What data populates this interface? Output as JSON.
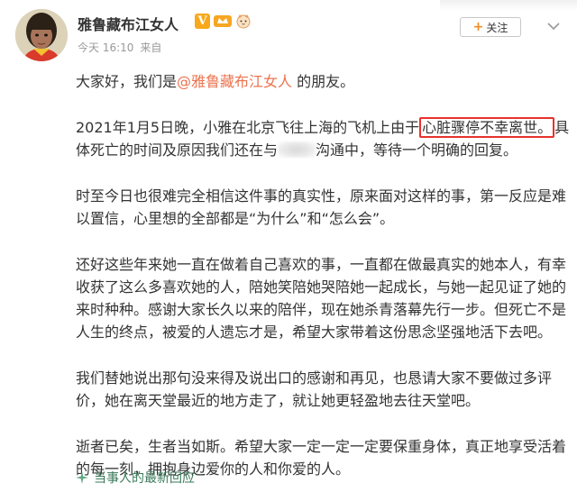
{
  "header": {
    "username": "雅鲁藏布江女人",
    "timestamp": "今天 16:10",
    "source_prefix": "来自",
    "follow_label": "关注",
    "verified_badge": "V"
  },
  "post": {
    "p1_before": "大家好，我们是",
    "p1_mention": "@雅鲁藏布江女人",
    "p1_after": " 的朋友。",
    "p2_before": "2021年1月5日晚，小雅在北京飞往上海的飞机上由于",
    "p2_highlight": "心脏骤停不幸离世。",
    "p2_middle": "具体死亡的时间及原因我们还在与",
    "p2_after": "沟通中，等待一个明确的回复。",
    "p3": "时至今日也很难完全相信这件事的真实性，原来面对这样的事，第一反应是难以置信，心里想的全部都是“为什么”和“怎么会”。",
    "p4": "还好这些年来她一直在做着自己喜欢的事，一直都在做最真实的她本人，有幸收获了这么多喜欢她的人，陪她笑陪她哭陪她一起成长，与她一起见证了她的来时种种。感谢大家长久以来的陪伴，现在她杀青落幕先行一步。但死亡不是人生的终点，被爱的人遗忘才是，希望大家带着这份思念坚强地活下去吧。",
    "p5": "我们替她说出那句没来得及说出口的感谢和再见，也恳请大家不要做过多评价，她在离天堂最近的地方走了，就让她更轻盈地去往天堂吧。",
    "p6": "逝者已矣，生者当如斯。希望大家一定一定一定要保重身体，真正地享受活着的每一刻，拥抱身边爱你的人和你爱的人。"
  },
  "footer": {
    "link_label": "当事人的最新回应"
  },
  "icons": {
    "more": "chevron-down-icon",
    "footer": "sparkle-icon"
  },
  "colors": {
    "mention": "#eb7350",
    "highlight_border": "#e8322b",
    "verified": "#f7a91b",
    "link": "#3a7a5a"
  }
}
